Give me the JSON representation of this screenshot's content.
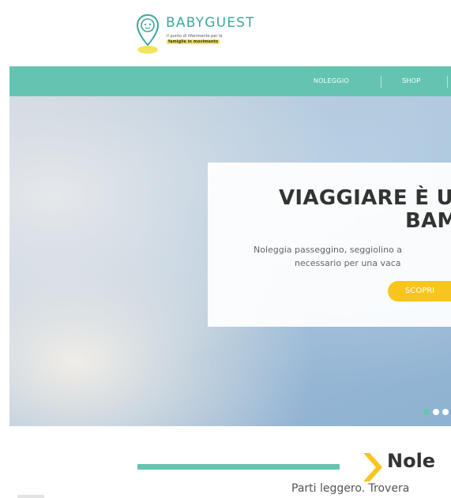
{
  "header": {
    "brand": "BABYGUEST",
    "tagline_1": "Il punto di riferimento per le",
    "tagline_2": "famiglie in movimento",
    "logo_icon": "pin-baby-icon"
  },
  "nav": {
    "items": [
      {
        "label": "NOLEGGIO"
      },
      {
        "label": "SHOP"
      }
    ]
  },
  "hero": {
    "title_line1": "VIAGGIARE È U",
    "title_line2": "BAM",
    "text_line1": "Noleggia passeggino, seggiolino a",
    "text_line2": "necessario per una vaca",
    "button_label": "SCOPRI",
    "slides_count": 3,
    "active_slide": 1
  },
  "section": {
    "title": "Nole",
    "subtitle": "Parti leggero. Trovera",
    "chevron_icon": "chevron-right-icon"
  },
  "colors": {
    "teal": "#64c4b1",
    "yellow": "#f7c51d",
    "text_dark": "#333333"
  }
}
